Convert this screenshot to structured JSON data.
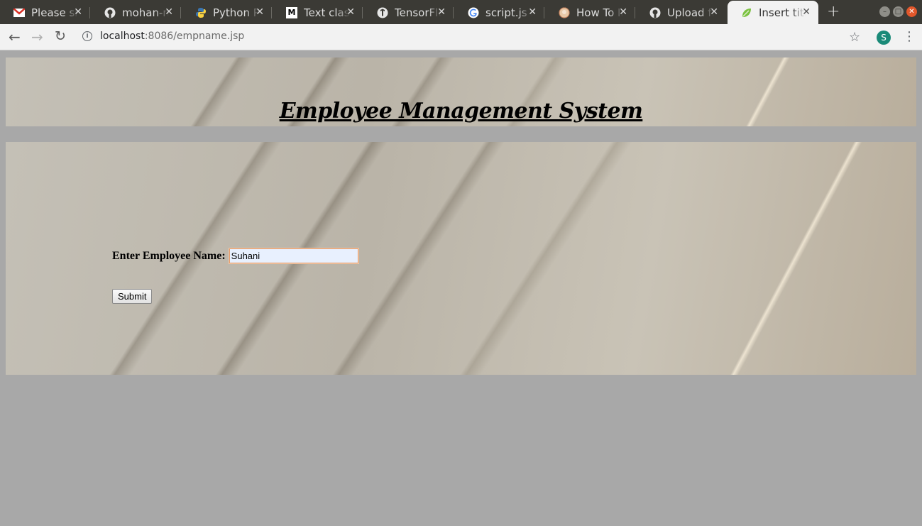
{
  "browser": {
    "tabs": [
      {
        "title": "Please sh",
        "icon": "gmail-icon",
        "active": false
      },
      {
        "title": "mohan-m",
        "icon": "github-icon",
        "active": false
      },
      {
        "title": "Python P",
        "icon": "python-icon",
        "active": false
      },
      {
        "title": "Text class",
        "icon": "medium-icon",
        "active": false
      },
      {
        "title": "TensorFlo",
        "icon": "tensorflow-icon",
        "active": false
      },
      {
        "title": "script.js n",
        "icon": "google-icon",
        "active": false
      },
      {
        "title": "How To Ir",
        "icon": "site-icon",
        "active": false
      },
      {
        "title": "Upload fi",
        "icon": "github-icon",
        "active": false
      },
      {
        "title": "Insert titl",
        "icon": "leaf-icon",
        "active": true
      }
    ],
    "new_tab_label": "+",
    "url_host": "localhost",
    "url_path": ":8086/empname.jsp",
    "profile_initial": "S",
    "profile_color": "#1a8a78"
  },
  "page": {
    "title": "Employee Management System",
    "form": {
      "label": "Enter Employee Name:",
      "input_value": "Suhani",
      "submit_label": "Submit"
    }
  },
  "colors": {
    "page_background": "#a8a8a8",
    "tabstrip": "#3b3a35",
    "toolbar": "#f2f2f2",
    "input_focus_border": "#e59b6a"
  }
}
